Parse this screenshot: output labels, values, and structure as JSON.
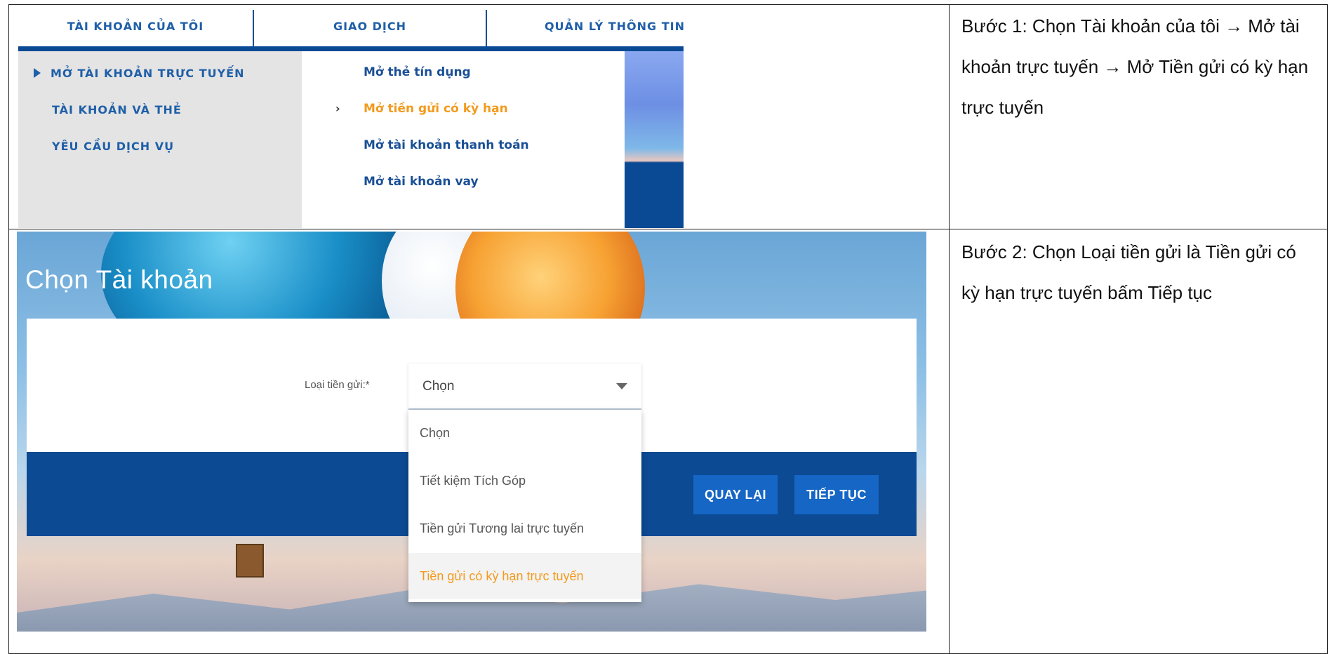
{
  "top_menu": {
    "tabs": [
      "TÀI KHOẢN CỦA TÔI",
      "GIAO DỊCH",
      "QUẢN LÝ THÔNG TIN"
    ],
    "left_items": [
      "MỞ TÀI KHOẢN TRỰC TUYẾN",
      "TÀI KHOẢN VÀ THẺ",
      "YÊU CẦU DỊCH VỤ"
    ],
    "sub_items": [
      "Mở thẻ tín dụng",
      "Mở tiền gửi có kỳ hạn",
      "Mở tài khoản thanh toán",
      "Mở tài khoản vay"
    ],
    "active_sub_index": 1,
    "active_color": "#f39a1d",
    "link_color": "#1a4f96"
  },
  "steps": {
    "step1": "Bước 1: Chọn Tài khoản của tôi → Mở tài khoản trực tuyến → Mở Tiền gửi có kỳ hạn trực tuyến",
    "step2": "Bước 2: Chọn Loại tiền gửi là Tiền gửi có kỳ hạn trực tuyến  bấm Tiếp tục"
  },
  "form": {
    "page_title": "Chọn Tài khoản",
    "field_label": "Loại tiền gửi:*",
    "select_value": "Chọn",
    "options": [
      "Chọn",
      "Tiết kiệm Tích Góp",
      "Tiền gửi Tương lai trực tuyến",
      "Tiền gửi có kỳ hạn trực tuyến"
    ],
    "selected_option_index": 3,
    "back_button": "QUAY LẠI",
    "next_button": "TIẾP TỤC",
    "footer_color": "#0c4a93",
    "button_color": "#1566c5"
  }
}
